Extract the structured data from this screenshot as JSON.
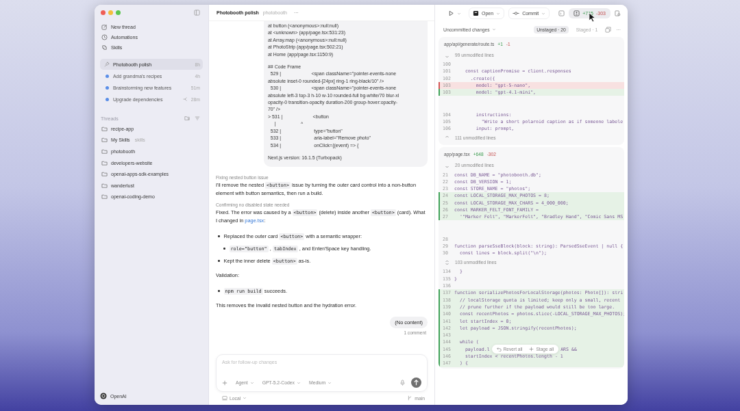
{
  "sidebar": {
    "nav": [
      {
        "label": "New thread"
      },
      {
        "label": "Automations"
      },
      {
        "label": "Skills"
      }
    ],
    "recent": [
      {
        "title": "Photobooth polish",
        "time": "8h",
        "selected": true,
        "pinned": true,
        "unread": false,
        "branch_icon": false
      },
      {
        "title": "Add grandma's recipes",
        "time": "4h",
        "selected": false,
        "pinned": false,
        "unread": true,
        "branch_icon": false
      },
      {
        "title": "Brainstorming new features",
        "time": "51m",
        "selected": false,
        "pinned": false,
        "unread": true,
        "branch_icon": false
      },
      {
        "title": "Upgrade dependencies",
        "time": "28m",
        "selected": false,
        "pinned": false,
        "unread": true,
        "branch_icon": true
      }
    ],
    "threads_label": "Threads",
    "projects": [
      {
        "name": "recipe-app"
      },
      {
        "name": "My Skills",
        "tag": "skills"
      },
      {
        "name": "photobooth"
      },
      {
        "name": "developers-website"
      },
      {
        "name": "openai-apps-sdk-examples"
      },
      {
        "name": "wanderlust"
      },
      {
        "name": "openai-coding-demo"
      }
    ],
    "account": "OpenAI"
  },
  "thread": {
    "title": "Photobooth polish",
    "project": "photobooth",
    "more": "···",
    "error_bubble": [
      [
        "at button (<anonymous>:null:null)",
        "at <unknown> (app/page.tsx:531:23)",
        "at Array.map (<anonymous>:null:null)",
        "at PhotoStrip (app/page.tsx:502:21)",
        "at Home (app/page.tsx:1150:9)"
      ],
      [
        "## Code Frame",
        "  529 |                       <span className=\"pointer-events-none",
        "absolute inset-0 rounded-[24px] ring-1 ring-black/10\" />",
        "  530 |                       <span className=\"pointer-events-none",
        "absolute left-3 top-3 h-10 w-10 rounded-full bg-white/70 blur-xl",
        "opacity-0 transition-opacity duration-200 group-hover:opacity-",
        "70\" />",
        "> 531 |                       <button",
        "     |                   ^",
        "  532 |                         type=\"button\"",
        "  533 |                         aria-label=\"Remove photo\"",
        "  534 |                         onClick={(event) => {"
      ],
      [
        "Next.js version: 16.1.5 (Turbopack)"
      ]
    ],
    "blocks": [
      {
        "kind": "status",
        "text": "Fixing nested button issue"
      },
      {
        "kind": "paragraph",
        "segments": [
          {
            "kind": "text",
            "text": "I'll remove the nested "
          },
          {
            "kind": "code",
            "text": "<button>"
          },
          {
            "kind": "text",
            "text": " issue by turning the outer card control into a non-button element with button semantics, then run a build."
          }
        ]
      },
      {
        "kind": "status",
        "text": "Confirming no disabled state needed"
      },
      {
        "kind": "paragraph",
        "segments": [
          {
            "kind": "text",
            "text": "Fixed. The error was caused by a "
          },
          {
            "kind": "code",
            "text": "<button>"
          },
          {
            "kind": "text",
            "text": " (delete) inside another "
          },
          {
            "kind": "code",
            "text": "<button>"
          },
          {
            "kind": "text",
            "text": " (card). What I changed in "
          },
          {
            "kind": "link",
            "text": "page.tsx"
          },
          {
            "kind": "text",
            "text": ":"
          }
        ]
      },
      {
        "kind": "list",
        "items": [
          {
            "segments": [
              {
                "kind": "text",
                "text": "Replaced the outer card "
              },
              {
                "kind": "code",
                "text": "<button>"
              },
              {
                "kind": "text",
                "text": " with a semantic wrapper:"
              }
            ],
            "children": [
              {
                "segments": [
                  {
                    "kind": "code",
                    "text": "role=\"button\""
                  },
                  {
                    "kind": "text",
                    "text": " , "
                  },
                  {
                    "kind": "code",
                    "text": "tabIndex"
                  },
                  {
                    "kind": "text",
                    "text": " , and Enter/Space key handling."
                  }
                ]
              }
            ]
          },
          {
            "segments": [
              {
                "kind": "text",
                "text": "Kept the inner delete "
              },
              {
                "kind": "code",
                "text": "<button>"
              },
              {
                "kind": "text",
                "text": " as-is."
              }
            ]
          }
        ]
      },
      {
        "kind": "paragraph",
        "segments": [
          {
            "kind": "text",
            "text": "Validation:"
          }
        ]
      },
      {
        "kind": "list",
        "items": [
          {
            "segments": [
              {
                "kind": "code",
                "text": "npm run build"
              },
              {
                "kind": "text",
                "text": " succeeds."
              }
            ]
          }
        ]
      },
      {
        "kind": "paragraph",
        "segments": [
          {
            "kind": "text",
            "text": "This removes the invalid nested button and the hydration error."
          }
        ]
      }
    ],
    "reply": {
      "text": "(No content)",
      "meta": "1 comment"
    },
    "composer": {
      "placeholder": "Ask for follow-up changes",
      "mode": "Agent",
      "model": "GPT-5.2-Codex",
      "effort": "Medium"
    },
    "footer": {
      "location": "Local",
      "branch": "main"
    }
  },
  "toolbar": {
    "open": "Open",
    "commit": "Commit",
    "added": "+715",
    "removed": "-303"
  },
  "changes": {
    "label": "Uncommitted changes",
    "tabs": [
      {
        "label": "Unstaged · 20",
        "selected": true
      },
      {
        "label": "Staged · 1",
        "selected": false
      }
    ],
    "more": "···",
    "files": [
      {
        "path": "app/api/generate/route.ts",
        "added": "+1",
        "removed": "-1",
        "rows": [
          {
            "kind": "collapsed",
            "text": "99 unmodified lines",
            "expand_down": true,
            "expand_up": false
          },
          {
            "kind": "context",
            "n": "100"
          },
          {
            "kind": "context",
            "n": "101",
            "code": "    const captionPromise = client.responses"
          },
          {
            "kind": "context",
            "n": "102",
            "code": "      .create({"
          },
          {
            "kind": "removed",
            "n": "103",
            "code": "        model: \"gpt-5-nano\","
          },
          {
            "kind": "added",
            "n": "103",
            "code": "        model: \"gpt-4.1-mini\","
          },
          {
            "kind": "spacer"
          },
          {
            "kind": "context",
            "n": "104",
            "code": "        instructions:"
          },
          {
            "kind": "context",
            "n": "105",
            "code": "          \"Write a short polaroid caption as if someone labele"
          },
          {
            "kind": "context",
            "n": "106",
            "code": "        input: prompt,"
          },
          {
            "kind": "collapsed",
            "text": "111 unmodified lines",
            "expand_down": false,
            "expand_up": true
          }
        ]
      },
      {
        "path": "app/page.tsx",
        "added": "+648",
        "removed": "-302",
        "rows": [
          {
            "kind": "collapsed",
            "text": "20 unmodified lines",
            "expand_down": true,
            "expand_up": false
          },
          {
            "kind": "context",
            "n": "21",
            "code": "const DB_NAME = \"photobooth.db\";"
          },
          {
            "kind": "context",
            "n": "22",
            "code": "const DB_VERSION = 1;"
          },
          {
            "kind": "context",
            "n": "23",
            "code": "const STORE_NAME = \"photos\";"
          },
          {
            "kind": "added",
            "n": "24",
            "code": "const LOCAL_STORAGE_MAX_PHOTOS = 8;"
          },
          {
            "kind": "added",
            "n": "25",
            "code": "const LOCAL_STORAGE_MAX_CHARS = 4_000_000;"
          },
          {
            "kind": "added",
            "n": "26",
            "code": "const MARKER_FELT_FONT_FAMILY ="
          },
          {
            "kind": "added",
            "n": "27",
            "code": "  '\"Marker Felt\", \"MarkerFelt\", \"Bradley Hand\", \"Comic Sans MS"
          },
          {
            "kind": "spacer"
          },
          {
            "kind": "context",
            "n": "28"
          },
          {
            "kind": "context",
            "n": "29",
            "code": "function parseSseBlock(block: string): ParsedSseEvent | null {"
          },
          {
            "kind": "context",
            "n": "30",
            "code": "  const lines = block.split(\"\\n\");"
          },
          {
            "kind": "collapsed",
            "text": "103 unmodified lines",
            "expand_down": true,
            "expand_up": true
          },
          {
            "kind": "context",
            "n": "134",
            "code": "  }"
          },
          {
            "kind": "context",
            "n": "135",
            "code": "}"
          },
          {
            "kind": "context",
            "n": "136"
          },
          {
            "kind": "added",
            "n": "137",
            "code": "function serializePhotosForLocalStorage(photos: Photo[]): stri"
          },
          {
            "kind": "added",
            "n": "138",
            "code": "  // localStorage quota is limited; keep only a small, recent"
          },
          {
            "kind": "added",
            "n": "139",
            "code": "  // prune further if the payload would still be too large."
          },
          {
            "kind": "added",
            "n": "140",
            "code": "  const recentPhotos = photos.slice(-LOCAL_STORAGE_MAX_PHOTOS);"
          },
          {
            "kind": "added",
            "n": "141",
            "code": "  let startIndex = 0;"
          },
          {
            "kind": "added",
            "n": "142",
            "code": "  let payload = JSON.stringify(recentPhotos);"
          },
          {
            "kind": "added",
            "n": "143"
          },
          {
            "kind": "added",
            "n": "144",
            "code": "  while ("
          },
          {
            "kind": "added",
            "n": "145",
            "code": "    payload.l",
            "actions": {
              "revert": "Revert all",
              "stage": "Stage all"
            },
            "code_after": "ARS &&"
          },
          {
            "kind": "added",
            "n": "146",
            "code": "    startIndex < recentPhotos.length - 1"
          },
          {
            "kind": "added",
            "n": "147",
            "code": "  ) {"
          }
        ]
      }
    ]
  }
}
